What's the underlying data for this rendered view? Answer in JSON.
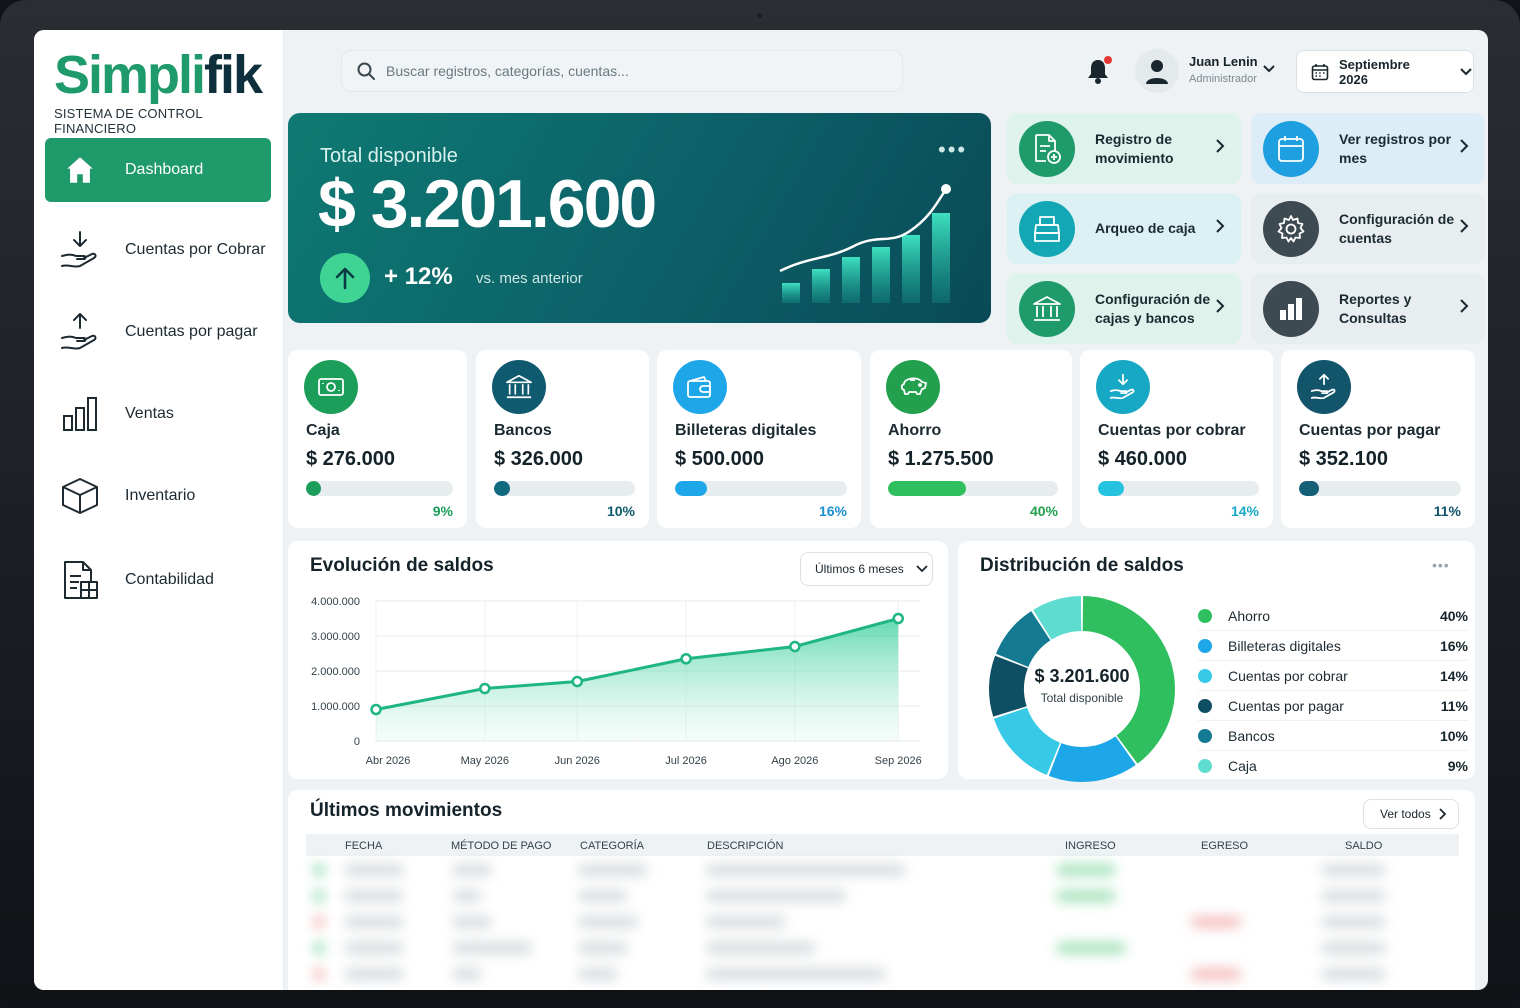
{
  "app": {
    "logo": {
      "part1": "Simpli",
      "part2": "fik"
    },
    "subtitle": "SISTEMA DE CONTROL FINANCIERO"
  },
  "sidebar": {
    "items": [
      {
        "label": "Dashboard",
        "icon": "home-icon",
        "active": true
      },
      {
        "label": "Cuentas por Cobrar",
        "icon": "hand-receive-icon"
      },
      {
        "label": "Cuentas por pagar",
        "icon": "hand-send-icon"
      },
      {
        "label": "Ventas",
        "icon": "bar-chart-icon"
      },
      {
        "label": "Inventario",
        "icon": "box-icon"
      },
      {
        "label": "Contabilidad",
        "icon": "ledger-icon"
      }
    ]
  },
  "topbar": {
    "search_placeholder": "Buscar registros, categorías, cuentas...",
    "user": {
      "name": "Juan Lenin",
      "role": "Administrador"
    },
    "period": "Septiembre 2026"
  },
  "hero": {
    "label": "Total disponible",
    "amount": "$ 3.201.600",
    "change": "+ 12%",
    "comparison": "vs. mes anterior",
    "menu": "•••"
  },
  "quick_actions": [
    {
      "label": "Registro de movimiento",
      "icon": "document-add-icon",
      "color": "#1f9a6b",
      "bg": "#ddf3ec"
    },
    {
      "label": "Ver registros por mes",
      "icon": "calendar-icon",
      "color": "#1e9fe0",
      "bg": "#dcedf8"
    },
    {
      "label": "Arqueo de caja",
      "icon": "cash-register-icon",
      "color": "#13a7b5",
      "bg": "#dcf1f3"
    },
    {
      "label": "Configuración de cuentas",
      "icon": "gear-icon",
      "color": "#3d4a52",
      "bg": "#e8edf0"
    },
    {
      "label": "Configuración de cajas y bancos",
      "icon": "bank-icon",
      "color": "#1f9a6b",
      "bg": "#ddf3ec"
    },
    {
      "label": "Reportes y Consultas",
      "icon": "report-chart-icon",
      "color": "#3d4a52",
      "bg": "#e8edf0"
    }
  ],
  "stats": [
    {
      "label": "Caja",
      "value": "$ 276.000",
      "percent": "9%",
      "fraction": 0.09,
      "color": "#1b9e5a",
      "pct_color": "#1b9e5a",
      "icon": "cash-icon"
    },
    {
      "label": "Bancos",
      "value": "$ 326.000",
      "percent": "10%",
      "fraction": 0.1,
      "color": "#126a80",
      "pct_color": "#0f5a6e",
      "icon": "bank-icon"
    },
    {
      "label": "Billeteras digitales",
      "value": "$ 500.000",
      "percent": "16%",
      "fraction": 0.16,
      "color": "#1ea7e8",
      "pct_color": "#1b8fcf",
      "icon": "wallet-icon"
    },
    {
      "label": "Ahorro",
      "value": "$ 1.275.500",
      "percent": "40%",
      "fraction": 0.4,
      "color": "#2fbf5e",
      "pct_color": "#22a04d",
      "icon": "piggy-bank-icon"
    },
    {
      "label": "Cuentas por cobrar",
      "value": "$ 460.000",
      "percent": "14%",
      "fraction": 0.14,
      "color": "#26c3e0",
      "pct_color": "#16a8c4",
      "icon": "hand-receive-icon"
    },
    {
      "label": "Cuentas por pagar",
      "value": "$ 352.100",
      "percent": "11%",
      "fraction": 0.11,
      "color": "#155f77",
      "pct_color": "#12546a",
      "icon": "hand-send-icon"
    }
  ],
  "evolution": {
    "title": "Evolución de saldos",
    "range": "Últimos 6 meses"
  },
  "distribution": {
    "title": "Distribución de saldos",
    "center_amount": "$ 3.201.600",
    "center_label": "Total disponible",
    "menu": "•••"
  },
  "movements": {
    "title": "Últimos movimientos",
    "view_all": "Ver todos",
    "columns": [
      "FECHA",
      "MÉTODO DE PAGO",
      "CATEGORÍA",
      "DESCRIPCIÓN",
      "INGRESO",
      "EGRESO",
      "SALDO"
    ]
  },
  "colors": {
    "brand_green": "#1f9a6b",
    "brand_dark": "#0e2f3c",
    "hero_bg": "#0c6068"
  },
  "chart_data": [
    {
      "type": "area",
      "title": "Evolución de saldos",
      "categories": [
        "Abr 2026",
        "May 2026",
        "Jun 2026",
        "Jul 2026",
        "Ago 2026",
        "Sep 2026"
      ],
      "x": [
        0,
        1,
        1.85,
        2.85,
        3.85,
        4.8
      ],
      "values": [
        900000,
        1500000,
        1700000,
        2350000,
        2700000,
        3500000
      ],
      "ylim": [
        0,
        4000000
      ],
      "yticks": [
        "4.000.000",
        "3.000.000",
        "2.000.000",
        "1.000.000",
        "0"
      ],
      "grid": true,
      "color": "#1fb584"
    },
    {
      "type": "pie",
      "title": "Distribución de saldos",
      "legend_position": "right",
      "slices": [
        {
          "name": "Ahorro",
          "value": 40,
          "label": "40%",
          "color": "#2fbf5e"
        },
        {
          "name": "Billeteras digitales",
          "value": 16,
          "label": "16%",
          "color": "#1ea7e8"
        },
        {
          "name": "Cuentas por cobrar",
          "value": 14,
          "label": "14%",
          "color": "#37c9e6"
        },
        {
          "name": "Cuentas por pagar",
          "value": 11,
          "label": "11%",
          "color": "#0f4f63"
        },
        {
          "name": "Bancos",
          "value": 10,
          "label": "10%",
          "color": "#137a92"
        },
        {
          "name": "Caja",
          "value": 9,
          "label": "9%",
          "color": "#5fdcd0"
        }
      ]
    }
  ]
}
